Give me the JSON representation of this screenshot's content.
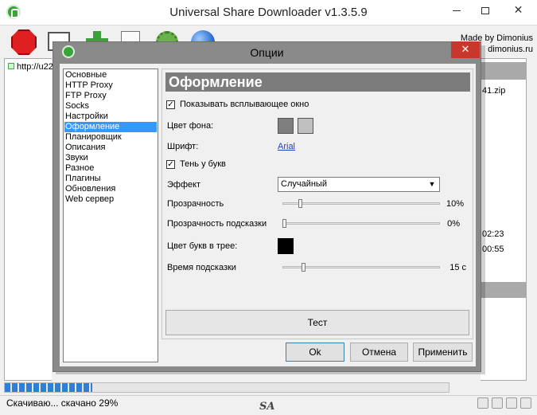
{
  "main_window": {
    "title": "Universal Share Downloader v1.3.5.9",
    "credit_line1": "Made by Dimonius",
    "credit_line2": "dimonius.ru",
    "list_item": "http://u22",
    "right_column": [
      "41.zip",
      "02:23",
      "00:55"
    ],
    "progress_percent": 29,
    "status_text": "Скачиваю... скачано 29%",
    "logo_text": "SA"
  },
  "dialog": {
    "title": "Опции",
    "close_label": "✕",
    "categories": [
      "Основные",
      "HTTP Proxy",
      "FTP Proxy",
      "Socks",
      "Настройки",
      "Оформление",
      "Планировщик",
      "Описания",
      "Звуки",
      "Разное",
      "Плагины",
      "Обновления",
      "Web сервер"
    ],
    "selected_category": "Оформление",
    "section_title": "Оформление",
    "show_popup": {
      "label": "Показывать всплывающее окно",
      "checked": true
    },
    "bg_color": {
      "label": "Цвет фона:",
      "colors": [
        "#7f7f7f",
        "#c0c0c0"
      ]
    },
    "font": {
      "label": "Шрифт:",
      "value": "Arial"
    },
    "letter_shadow": {
      "label": "Тень у букв",
      "checked": true
    },
    "effect": {
      "label": "Эффект",
      "value": "Случайный"
    },
    "transparency": {
      "label": "Прозрачность",
      "value_text": "10%",
      "level": 0.1
    },
    "hint_transparency": {
      "label": "Прозрачность подсказки",
      "value_text": "0%",
      "level": 0.0
    },
    "tray_letter_color": {
      "label": "Цвет букв в трее:",
      "color": "#000000"
    },
    "hint_time": {
      "label": "Время подсказки",
      "value_text": "15 с",
      "level": 0.12
    },
    "test_label": "Тест",
    "ok_label": "Ok",
    "cancel_label": "Отмена",
    "apply_label": "Применить"
  }
}
